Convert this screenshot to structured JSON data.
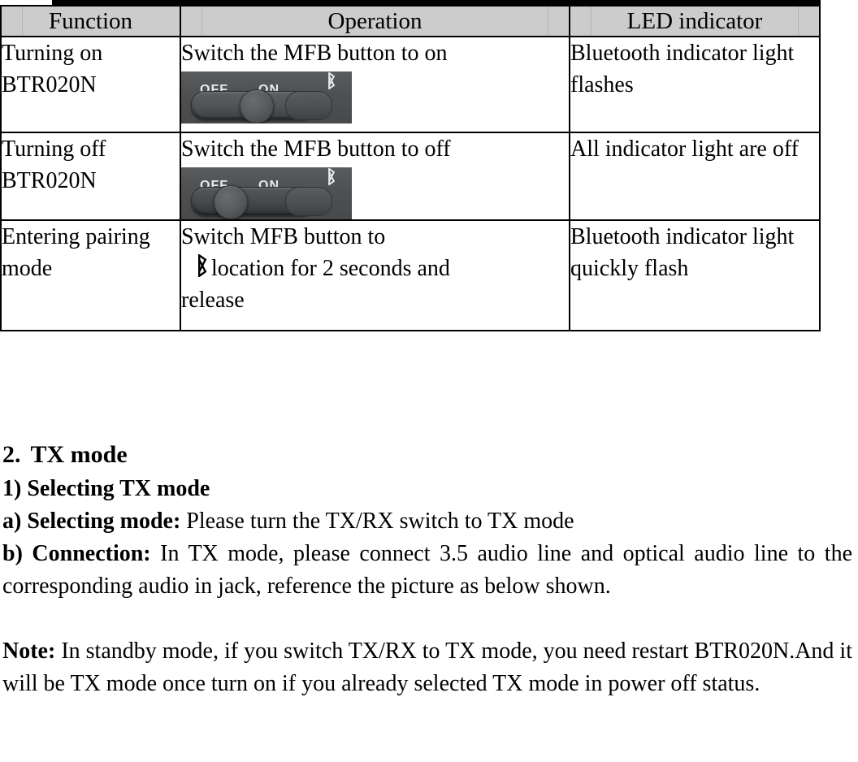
{
  "document": {
    "type": "product-manual-page",
    "product": "BTR020N"
  },
  "table": {
    "headers": [
      "Function",
      "Operation",
      "LED indicator"
    ],
    "header_bg": "#cccccc",
    "rows": [
      {
        "function": "Turning on BTR020N",
        "operation_text": "Switch the MFB button to on",
        "operation_image": {
          "name": "mfb-slider-switch-on",
          "labels": [
            "OFF",
            "ON"
          ],
          "bluetooth_glyph": "␢",
          "knob_position": "on"
        },
        "led": "Bluetooth indicator light flashes"
      },
      {
        "function": "Turning off BTR020N",
        "operation_text": "Switch the MFB button to off",
        "operation_image": {
          "name": "mfb-slider-switch-off",
          "labels": [
            "OFF",
            "ON"
          ],
          "bluetooth_glyph": "␢",
          "knob_position": "off"
        },
        "led": "All indicator light are off"
      },
      {
        "function": "Entering pairing mode",
        "operation_line1": "Switch MFB button to",
        "operation_icon": "bluetooth-icon",
        "operation_line2": "location for 2 seconds and",
        "operation_line3": "release",
        "led": "Bluetooth indicator light quickly flash"
      }
    ]
  },
  "section": {
    "number": "2.",
    "title": "TX mode",
    "sub_heading": "1) Selecting TX mode",
    "items": [
      {
        "label": "a) Selecting mode:",
        "text": " Please turn the TX/RX switch to TX mode"
      },
      {
        "label": "b) Connection:",
        "text": " In TX mode, please connect 3.5 audio line and optical audio line to the corresponding audio in jack, reference the picture as below shown."
      }
    ],
    "note": {
      "label": "Note:",
      "text": " In standby mode, if you switch TX/RX to TX mode, you need restart BTR020N.And it will be TX mode once turn on if you already selected TX mode in power off status."
    }
  }
}
